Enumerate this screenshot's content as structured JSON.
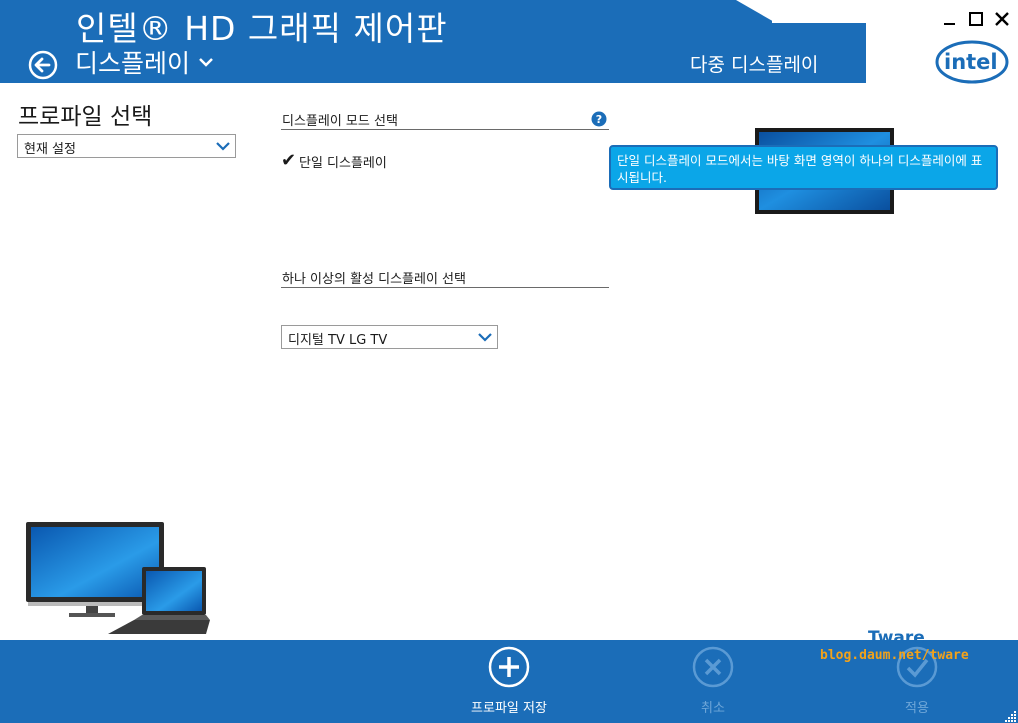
{
  "app": {
    "title": "인텔® HD 그래픽 제어판",
    "section": "디스플레이",
    "subsection": "다중 디스플레이",
    "logo_text": "intel",
    "window_controls": [
      "minimize",
      "maximize",
      "close"
    ]
  },
  "profile": {
    "title": "프로파일 선택",
    "selected": "현재 설정"
  },
  "mode": {
    "label": "디스플레이 모드 선택",
    "help_icon": "question-icon",
    "option_checked": "단일 디스플레이",
    "tooltip": "단일 디스플레이 모드에서는 바탕 화면 영역이 하나의 디스플레이에 표시됩니다."
  },
  "active": {
    "label": "하나 이상의 활성 디스플레이 선택",
    "selected": "디지털 TV LG TV"
  },
  "footer": {
    "save_label": "프로파일 저장",
    "cancel_label": "취소",
    "apply_label": "적용"
  },
  "watermark": {
    "name": "Tware",
    "url": "blog.daum.net/tware"
  },
  "colors": {
    "brand_blue": "#1b6db8",
    "tooltip_blue": "#0ba6e8",
    "watermark_orange": "#f2a21a"
  }
}
